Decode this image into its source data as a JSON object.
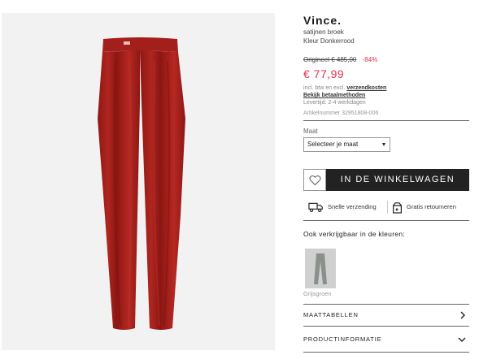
{
  "product": {
    "brand": "Vince.",
    "name": "satijnen broek",
    "color_line": "Kleur Donkerrood",
    "original_price": "Origineel € 485,00",
    "discount": "-84%",
    "price": "€ 77,99",
    "tax_text": "incl. btw en excl.",
    "shipping_link": "verzendkosten",
    "payment_link": "Bekijk betaalmethoden",
    "delivery": "Levertijd: 2-4 werkdagen",
    "article_nr": "Artikelnummer 32951808-006",
    "image_color": "#a51f1c"
  },
  "size": {
    "label": "Maat",
    "selected": "Selecteer je maat"
  },
  "actions": {
    "wishlist_icon": "heart-icon",
    "cart_label": "IN DE WINKELWAGEN"
  },
  "usps": [
    {
      "icon": "truck-icon",
      "label": "Snelle verzending"
    },
    {
      "icon": "return-box-icon",
      "label": "Gratis retourneren"
    }
  ],
  "colors": {
    "label": "Ook verkrijgbaar in de kleuren:",
    "options": [
      {
        "name": "Grijsgroen",
        "hex": "#c8c8c8"
      }
    ]
  },
  "accordions": [
    {
      "label": "MAATTABELLEN",
      "icon": "chevron-right-icon"
    },
    {
      "label": "PRODUCTINFORMATIE",
      "icon": "chevron-down-icon"
    }
  ]
}
